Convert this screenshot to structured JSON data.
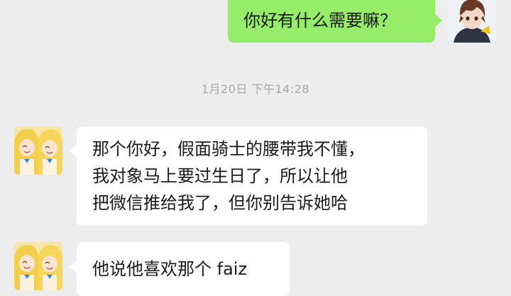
{
  "chat": {
    "messages": [
      {
        "sender": "me",
        "text": "你好有什么需要嘛？"
      },
      {
        "sender": "contact",
        "text": "那个你好，假面骑士的腰带我不懂，\n我对象马上要过生日了，所以让他\n把微信推给我了，但你别告诉她哈"
      },
      {
        "sender": "contact",
        "text": "他说他喜欢那个 faiz"
      }
    ],
    "timestamp": "1月20日 下午14:28"
  },
  "colors": {
    "background": "#ededed",
    "outgoing_bubble": "#95ec69",
    "incoming_bubble": "#ffffff",
    "timestamp_text": "#a8a8a8"
  },
  "icons": {
    "my_avatar": "anime-boy-avatar",
    "contact_avatar": "anime-twins-avatar"
  }
}
